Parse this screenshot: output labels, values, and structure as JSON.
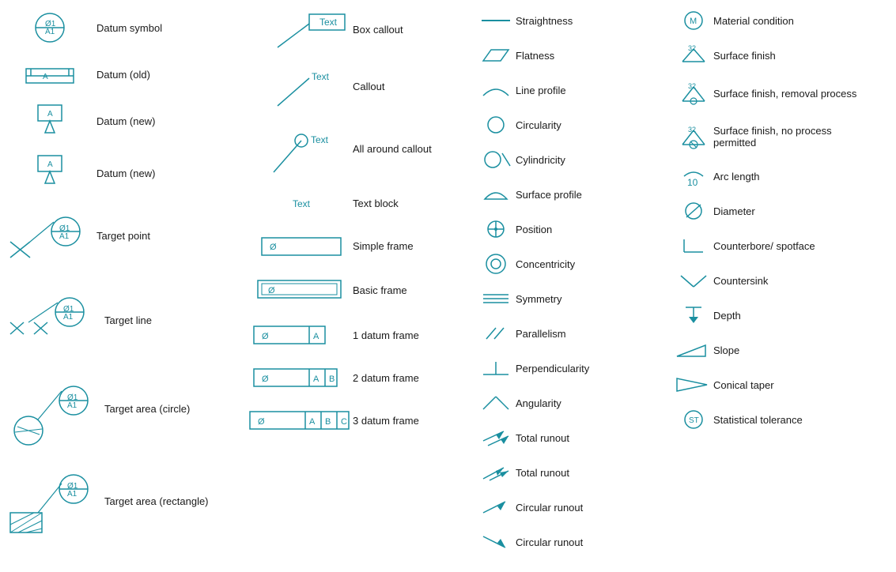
{
  "col1": {
    "items": [
      {
        "id": "datum-symbol",
        "label": "Datum symbol"
      },
      {
        "id": "datum-old",
        "label": "Datum (old)"
      },
      {
        "id": "datum-new1",
        "label": "Datum (new)"
      },
      {
        "id": "datum-new2",
        "label": "Datum (new)"
      },
      {
        "id": "target-point",
        "label": "Target point"
      },
      {
        "id": "target-line",
        "label": "Target line"
      },
      {
        "id": "target-area-circle",
        "label": "Target area (circle)"
      },
      {
        "id": "target-area-rectangle",
        "label": "Target area (rectangle)"
      }
    ]
  },
  "col2": {
    "items": [
      {
        "id": "box-callout",
        "label": "Box callout"
      },
      {
        "id": "callout",
        "label": "Callout"
      },
      {
        "id": "all-around-callout",
        "label": "All around callout"
      },
      {
        "id": "text-block",
        "label": "Text block"
      },
      {
        "id": "simple-frame",
        "label": "Simple frame"
      },
      {
        "id": "basic-frame",
        "label": "Basic frame"
      },
      {
        "id": "one-datum-frame",
        "label": "1 datum frame"
      },
      {
        "id": "two-datum-frame",
        "label": "2 datum frame"
      },
      {
        "id": "three-datum-frame",
        "label": "3 datum frame"
      }
    ]
  },
  "col3": {
    "items": [
      {
        "id": "straightness",
        "label": "Straightness"
      },
      {
        "id": "flatness",
        "label": "Flatness"
      },
      {
        "id": "line-profile",
        "label": "Line profile"
      },
      {
        "id": "circularity",
        "label": "Circularity"
      },
      {
        "id": "cylindricity",
        "label": "Cylindricity"
      },
      {
        "id": "surface-profile",
        "label": "Surface profile"
      },
      {
        "id": "position",
        "label": "Position"
      },
      {
        "id": "concentricity",
        "label": "Concentricity"
      },
      {
        "id": "symmetry",
        "label": "Symmetry"
      },
      {
        "id": "parallelism",
        "label": "Parallelism"
      },
      {
        "id": "perpendicularity",
        "label": "Perpendicularity"
      },
      {
        "id": "angularity",
        "label": "Angularity"
      },
      {
        "id": "total-runout",
        "label": "Total runout"
      },
      {
        "id": "total-runout2",
        "label": "Total runout"
      },
      {
        "id": "circular-runout",
        "label": "Circular runout"
      },
      {
        "id": "circular-runout2",
        "label": "Circular runout"
      }
    ]
  },
  "col4": {
    "items": [
      {
        "id": "material-condition",
        "label": "Material condition"
      },
      {
        "id": "surface-finish",
        "label": "Surface finish"
      },
      {
        "id": "surface-finish-removal",
        "label": "Surface finish, removal process"
      },
      {
        "id": "surface-finish-no-process",
        "label": "Surface finish, no process permitted"
      },
      {
        "id": "arc-length",
        "label": "Arc length"
      },
      {
        "id": "diameter",
        "label": "Diameter"
      },
      {
        "id": "counterbore-spotface",
        "label": "Counterbore/ spotface"
      },
      {
        "id": "countersink",
        "label": "Countersink"
      },
      {
        "id": "depth",
        "label": "Depth"
      },
      {
        "id": "slope",
        "label": "Slope"
      },
      {
        "id": "conical-taper",
        "label": "Conical taper"
      },
      {
        "id": "statistical-tolerance",
        "label": "Statistical tolerance"
      }
    ]
  }
}
